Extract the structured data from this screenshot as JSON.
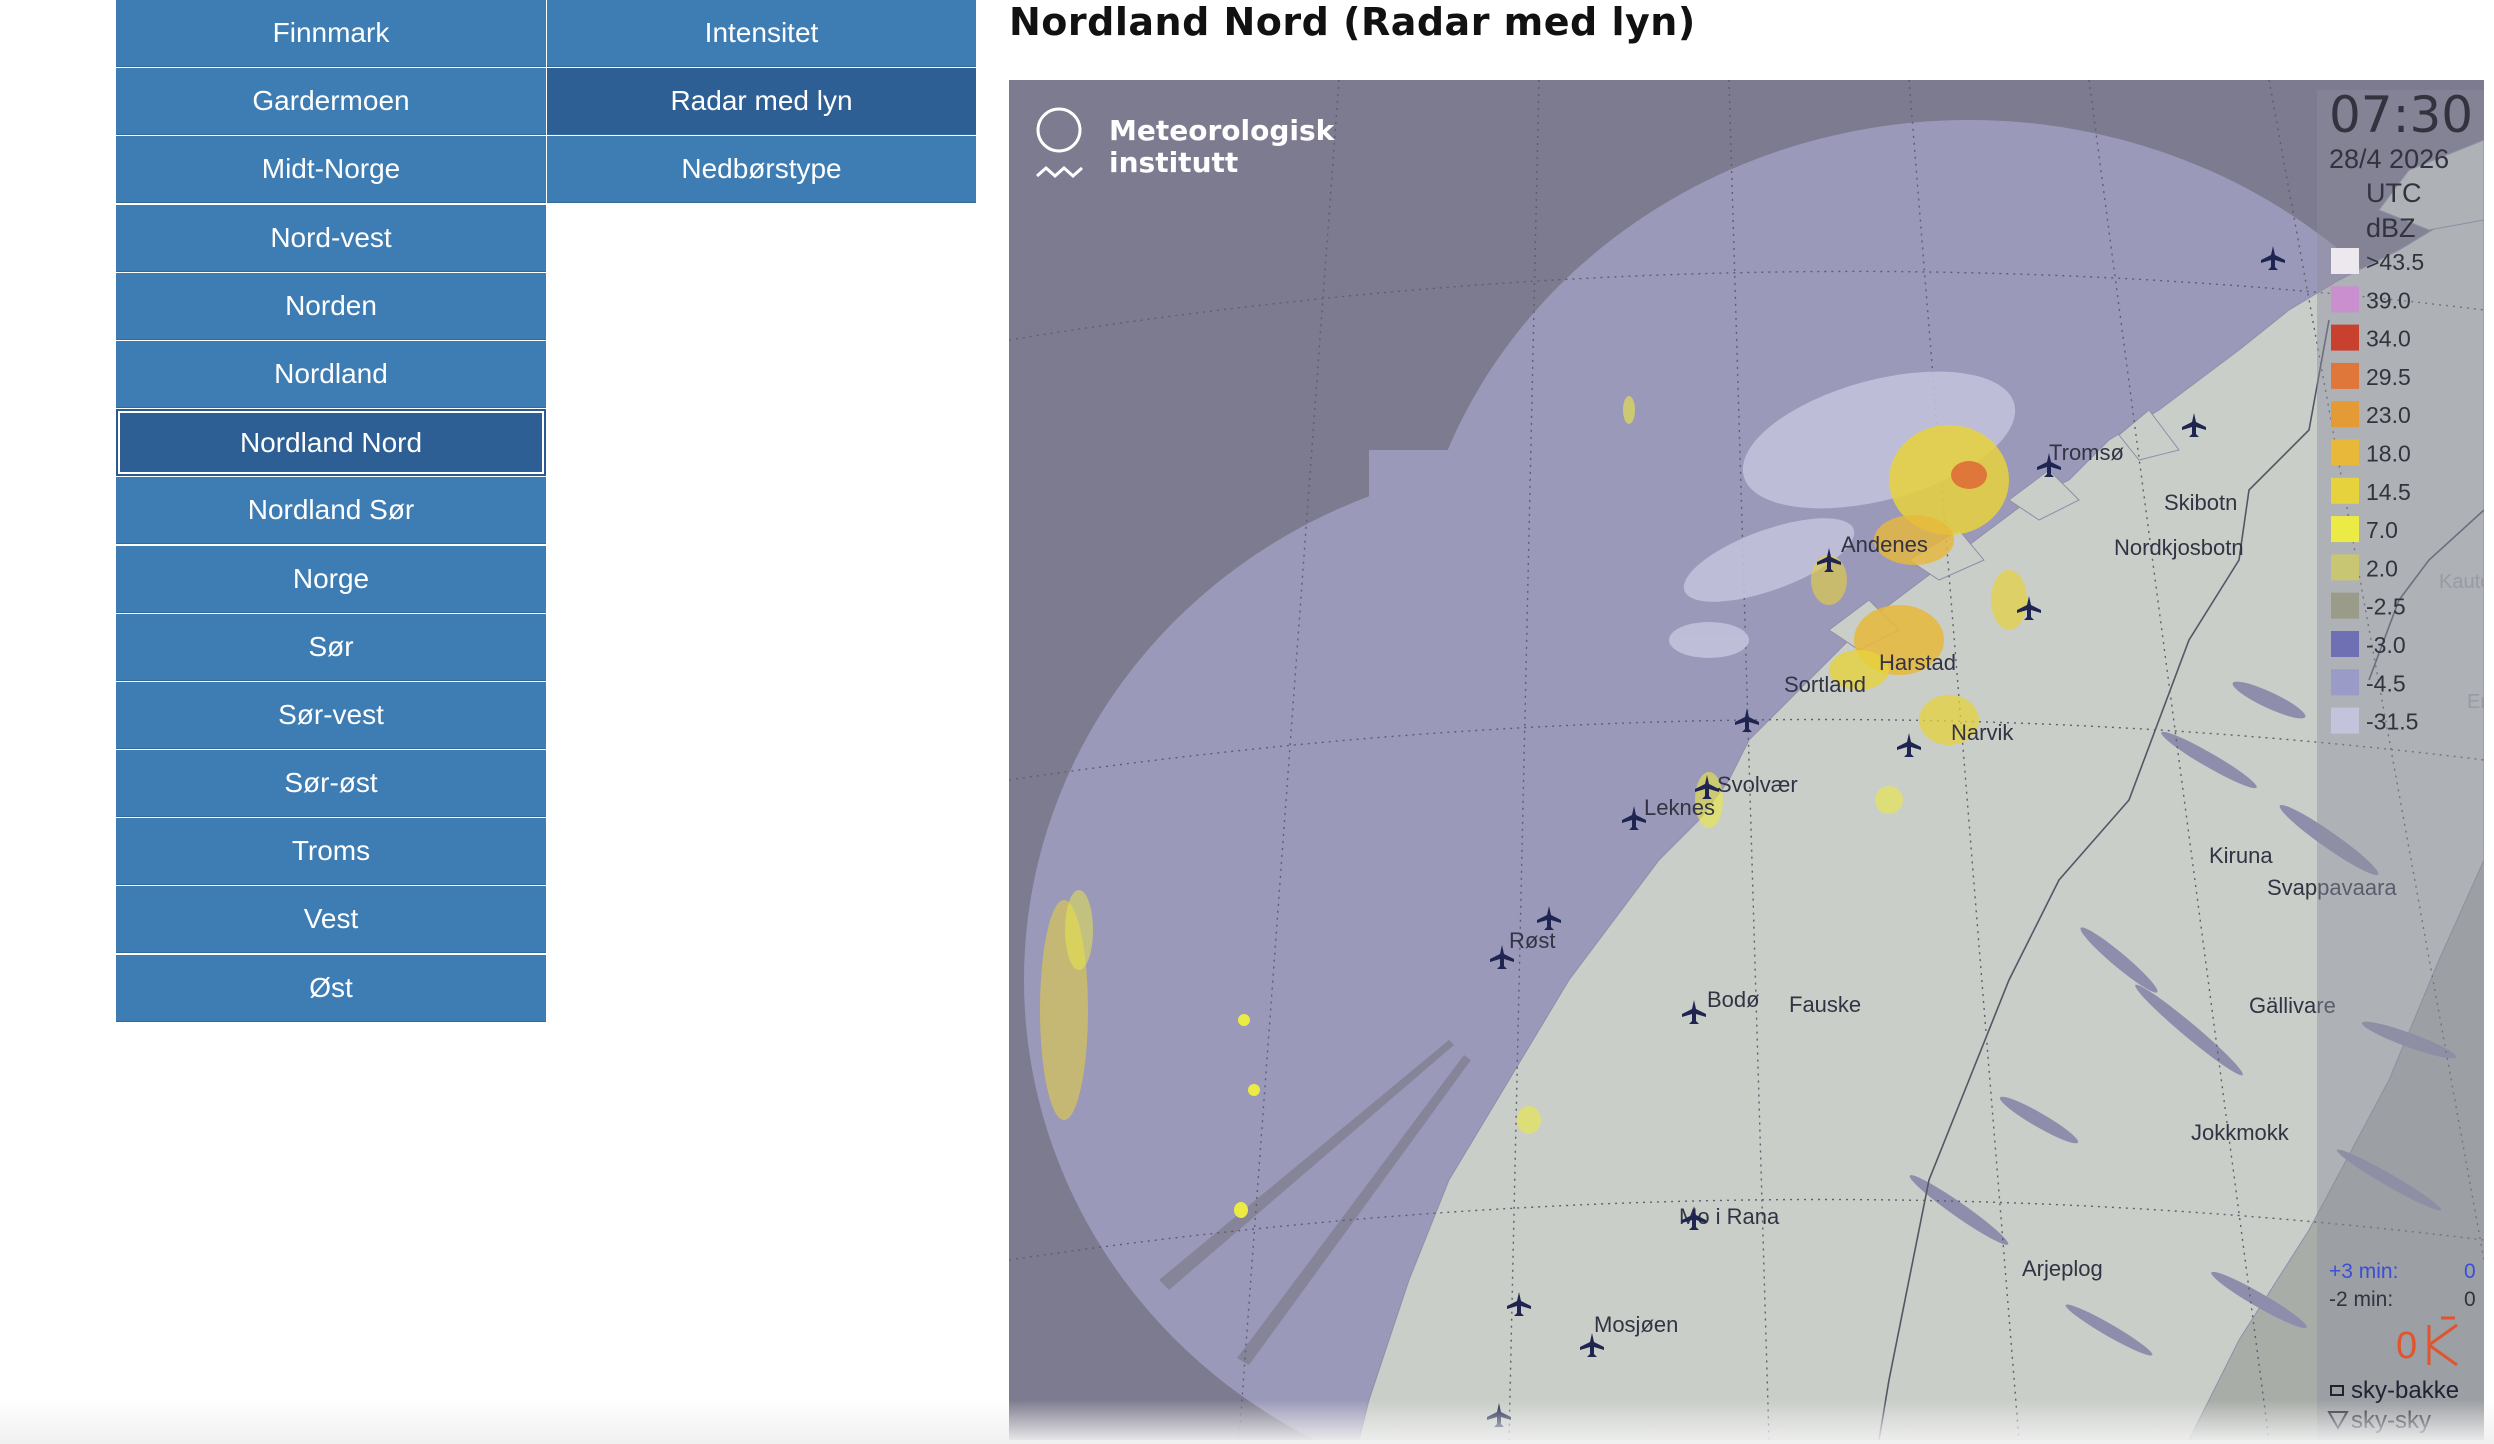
{
  "regions": [
    {
      "label": "Finnmark"
    },
    {
      "label": "Gardermoen"
    },
    {
      "label": "Midt-Norge"
    },
    {
      "label": "Nord-vest"
    },
    {
      "label": "Norden"
    },
    {
      "label": "Nordland"
    },
    {
      "label": "Nordland Nord",
      "selected": true
    },
    {
      "label": "Nordland Sør"
    },
    {
      "label": "Norge"
    },
    {
      "label": "Sør"
    },
    {
      "label": "Sør-vest"
    },
    {
      "label": "Sør-øst"
    },
    {
      "label": "Troms"
    },
    {
      "label": "Vest"
    },
    {
      "label": "Øst"
    }
  ],
  "products": [
    {
      "label": "Intensitet"
    },
    {
      "label": "Radar med lyn",
      "active": true
    },
    {
      "label": "Nedbørstype"
    }
  ],
  "page_title": "Nordland Nord (Radar med lyn)",
  "map": {
    "logo_line1": "Meteorologisk",
    "logo_line2": "institutt",
    "time": "07:30",
    "date": "28/4 2026",
    "tz": "UTC",
    "unit": "dBZ",
    "legend": [
      {
        "label": ">43.5",
        "color": "#ede8ee"
      },
      {
        "label": "39.0",
        "color": "#c98fcf"
      },
      {
        "label": "34.0",
        "color": "#c8412f"
      },
      {
        "label": "29.5",
        "color": "#e0773a"
      },
      {
        "label": "23.0",
        "color": "#e49a35"
      },
      {
        "label": "18.0",
        "color": "#e7b83a"
      },
      {
        "label": "14.5",
        "color": "#e6d23c"
      },
      {
        "label": "7.0",
        "color": "#ecea45"
      },
      {
        "label": "2.0",
        "color": "#c8c673"
      },
      {
        "label": "-2.5",
        "color": "#9a9b88"
      },
      {
        "label": "-3.0",
        "color": "#6f70b3"
      },
      {
        "label": "-4.5",
        "color": "#9b9bc7"
      },
      {
        "label": "-31.5",
        "color": "#c4c3dc"
      }
    ],
    "lightning_plus_label": "+3 min:",
    "lightning_plus_value": "0",
    "lightning_minus_label": "-2 min:",
    "lightning_minus_value": "0",
    "lightning_total": "0",
    "cg_label": "sky-bakke",
    "cc_label": "sky-sky",
    "places": [
      {
        "name": "Tromsø"
      },
      {
        "name": "Skibotn"
      },
      {
        "name": "Nordkjosbotn"
      },
      {
        "name": "Andenes"
      },
      {
        "name": "Harstad"
      },
      {
        "name": "Sortland"
      },
      {
        "name": "Narvik"
      },
      {
        "name": "Svolvær"
      },
      {
        "name": "Leknes"
      },
      {
        "name": "Røst"
      },
      {
        "name": "Bodø"
      },
      {
        "name": "Fauske"
      },
      {
        "name": "Kiruna"
      },
      {
        "name": "Svappavaara"
      },
      {
        "name": "Gällivare"
      },
      {
        "name": "Jokkmokk"
      },
      {
        "name": "Mo i Rana"
      },
      {
        "name": "Arjeplog"
      },
      {
        "name": "Mosjøen"
      },
      {
        "name": "Kautokeino"
      },
      {
        "name": "En"
      }
    ],
    "colors": {
      "outside_radar": "#7d7b8f",
      "radar_sea": "#9a98b8",
      "land": "#c9cec9",
      "land_outside": "#a7aca7",
      "accent_menu": "#3d7db4",
      "accent_menu_active": "#2d5f95"
    }
  }
}
